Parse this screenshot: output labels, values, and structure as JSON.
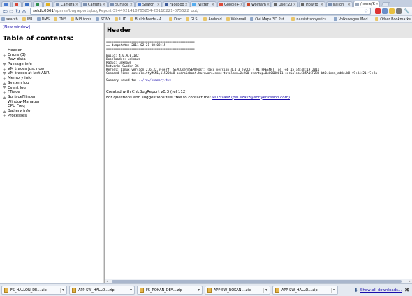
{
  "tabs": [
    {
      "label": "",
      "color": "#4a7bd0",
      "mini": true
    },
    {
      "label": "",
      "color": "#d44638",
      "mini": true
    },
    {
      "label": "",
      "color": "#3b6fc2",
      "mini": true
    },
    {
      "label": "",
      "color": "#2f8f4e",
      "mini": true
    },
    {
      "label": "",
      "color": "#e0b020",
      "mini": true
    },
    {
      "label": "Camera",
      "color": "#7a8fb0"
    },
    {
      "label": "Camera",
      "color": "#7a8fb0"
    },
    {
      "label": "Surface",
      "color": "#7a8fb0"
    },
    {
      "label": "Search",
      "color": "#4a7bd0"
    },
    {
      "label": "Faceboo",
      "color": "#3b5998"
    },
    {
      "label": "Twitter",
      "color": "#55acee"
    },
    {
      "label": "Google+",
      "color": "#dd4b39"
    },
    {
      "label": "Wolfram",
      "color": "#c9472b"
    },
    {
      "label": "User:20",
      "color": "#666666"
    },
    {
      "label": "How to",
      "color": "#666666"
    },
    {
      "label": "hallon",
      "color": "#7a8fb0"
    },
    {
      "label": "/home/K",
      "color": "#9aa7ba",
      "active": true
    }
  ],
  "toolbar": {
    "back": "⇦",
    "forward": "⇨",
    "reload": "↻",
    "home": "⌂",
    "url_host": "seldlx0361",
    "url_path": "/sparse/bugreports/bugReport-3944921418765254-20110221-075522_out/",
    "star": "☆",
    "wrench": "🔧"
  },
  "bookmarks": [
    {
      "label": "search",
      "folder": false
    },
    {
      "label": "IPR",
      "folder": true
    },
    {
      "label": "DMS",
      "folder": false
    },
    {
      "label": "DMS",
      "folder": true
    },
    {
      "label": "MIB tools",
      "folder": true
    },
    {
      "label": "SONY",
      "folder": false
    },
    {
      "label": "LUT",
      "folder": true
    },
    {
      "label": "BuildsFeeds - A...",
      "folder": true
    },
    {
      "label": "Disc",
      "folder": true
    },
    {
      "label": "GLSL",
      "folder": true
    },
    {
      "label": "Android",
      "folder": true
    },
    {
      "label": "Webmail",
      "folder": true
    },
    {
      "label": "Ovi Maps 3D Put...",
      "folder": false
    },
    {
      "label": "nassist.sonyerics...",
      "folder": true
    },
    {
      "label": "Volkswagen Med...",
      "folder": false
    }
  ],
  "other_bookmarks": "Other Bookmarks",
  "left": {
    "new_window": "[New window]",
    "toc_title": "Table of contents:",
    "items": [
      {
        "label": "Header",
        "expandable": false
      },
      {
        "label": "Errors (3)",
        "expandable": true
      },
      {
        "label": "Raw data",
        "expandable": false
      },
      {
        "label": "Package info",
        "expandable": true
      },
      {
        "label": "VM traces just now",
        "expandable": true
      },
      {
        "label": "VM traces at last ANR",
        "expandable": true
      },
      {
        "label": "Memory info",
        "expandable": true
      },
      {
        "label": "System log",
        "expandable": true
      },
      {
        "label": "Event log",
        "expandable": true
      },
      {
        "label": "FTrace",
        "expandable": true
      },
      {
        "label": "SurfaceFlinger",
        "expandable": true
      },
      {
        "label": "WindowManager",
        "expandable": false
      },
      {
        "label": "CPU Freq",
        "expandable": false
      },
      {
        "label": "Battery info",
        "expandable": true
      },
      {
        "label": "Processes",
        "expandable": true
      }
    ]
  },
  "right": {
    "header": "Header",
    "pre_lines": [
      "=================================================",
      "== dumpstate: 2011-02-21 08:02:15",
      "=================================================",
      "",
      "Build: 4.0.A.0.182",
      "Bootloader: unknown",
      "Radio: unknown",
      "Network: Sweden 3G",
      "Kernel: Linux version 2.6.32.9-perf (SEMCUser@SEMCHost) (gcc version 4.4.3 (GCC) ) #1 PREEMPT Tue Feb 15 14:48:19 2011",
      "Command line: console=ttyMSM1,115200n8 androidboot.hardware=semc totalmem=0x200 startup=0x00000011 serialno=CB5A1CFZ8U bt0.ieee_addr=b8:f9:34:21:f7:2a"
    ],
    "summary_prefix": "Summary saved to: ",
    "summary_link": "../raw/summary.txt",
    "created": "Created with ChkBugReport v0.3 (rel 112)",
    "questions": "For questions and suggestions feel free to contact me: ",
    "contact": "Pal Szasz (pal.szasz@sonyericsson.com)"
  },
  "downloads": [
    "FS_HALLON_DE....zip",
    "APP-SW_HALLO....zip",
    "FS_ROKAN_DEV....zip",
    "APP-SW_ROKAN....zip",
    "APP-SW_HALLO....zip"
  ],
  "show_all": "Show all downloads...",
  "close": "✖"
}
